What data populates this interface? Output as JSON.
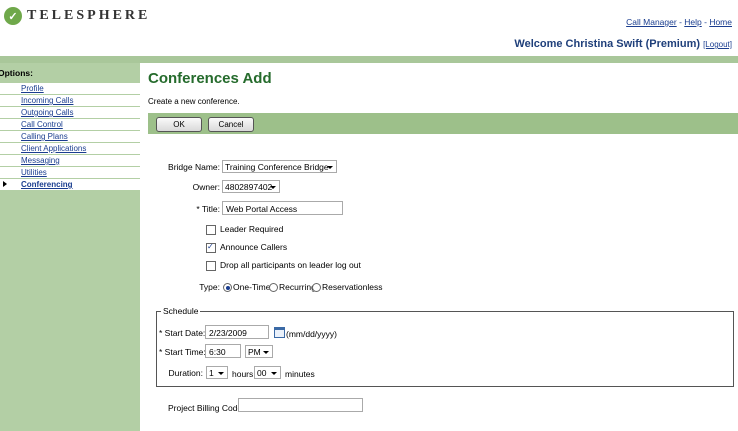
{
  "header": {
    "logo_text": "TELESPHERE",
    "links": {
      "call_manager": "Call Manager",
      "sep1": " - ",
      "help": "Help",
      "sep2": " - ",
      "home": "Home"
    },
    "welcome": "Welcome Christina Swift (Premium)",
    "logout": "[Logout]"
  },
  "sidebar": {
    "title": "Options:",
    "items": [
      {
        "label": "Profile"
      },
      {
        "label": "Incoming Calls"
      },
      {
        "label": "Outgoing Calls"
      },
      {
        "label": "Call Control"
      },
      {
        "label": "Calling Plans"
      },
      {
        "label": "Client Applications"
      },
      {
        "label": "Messaging"
      },
      {
        "label": "Utilities"
      },
      {
        "label": "Conferencing"
      }
    ],
    "active": "Conferencing"
  },
  "main": {
    "title": "Conferences Add",
    "subtitle": "Create a new conference.",
    "buttons": {
      "ok": "OK",
      "cancel": "Cancel"
    }
  },
  "form": {
    "bridge_name_label": "Bridge Name:",
    "bridge_name_value": "Training Conference Bridge",
    "owner_label": "Owner:",
    "owner_value": "4802897402",
    "title_label": "* Title:",
    "title_value": "Web Portal Access",
    "leader_required": {
      "label": "Leader Required",
      "checked": false
    },
    "announce_callers": {
      "label": "Announce Callers",
      "checked": true
    },
    "drop_all": {
      "label": "Drop all participants on leader log out",
      "checked": false
    },
    "type_label": "Type:",
    "type_options": [
      "One-Time",
      "Recurring",
      "Reservationless"
    ],
    "type_selected": "One-Time",
    "schedule_legend": "Schedule",
    "start_date_label": "* Start Date:",
    "start_date_value": "2/23/2009",
    "date_format": "(mm/dd/yyyy)",
    "start_time_label": "* Start Time:",
    "start_time_value": "6:30",
    "ampm_value": "PM",
    "duration_label": "Duration:",
    "duration_hours": "1",
    "hours_label": "hours",
    "duration_minutes": "00",
    "minutes_label": "minutes",
    "billing_label": "Project Billing Code:",
    "billing_value": ""
  }
}
